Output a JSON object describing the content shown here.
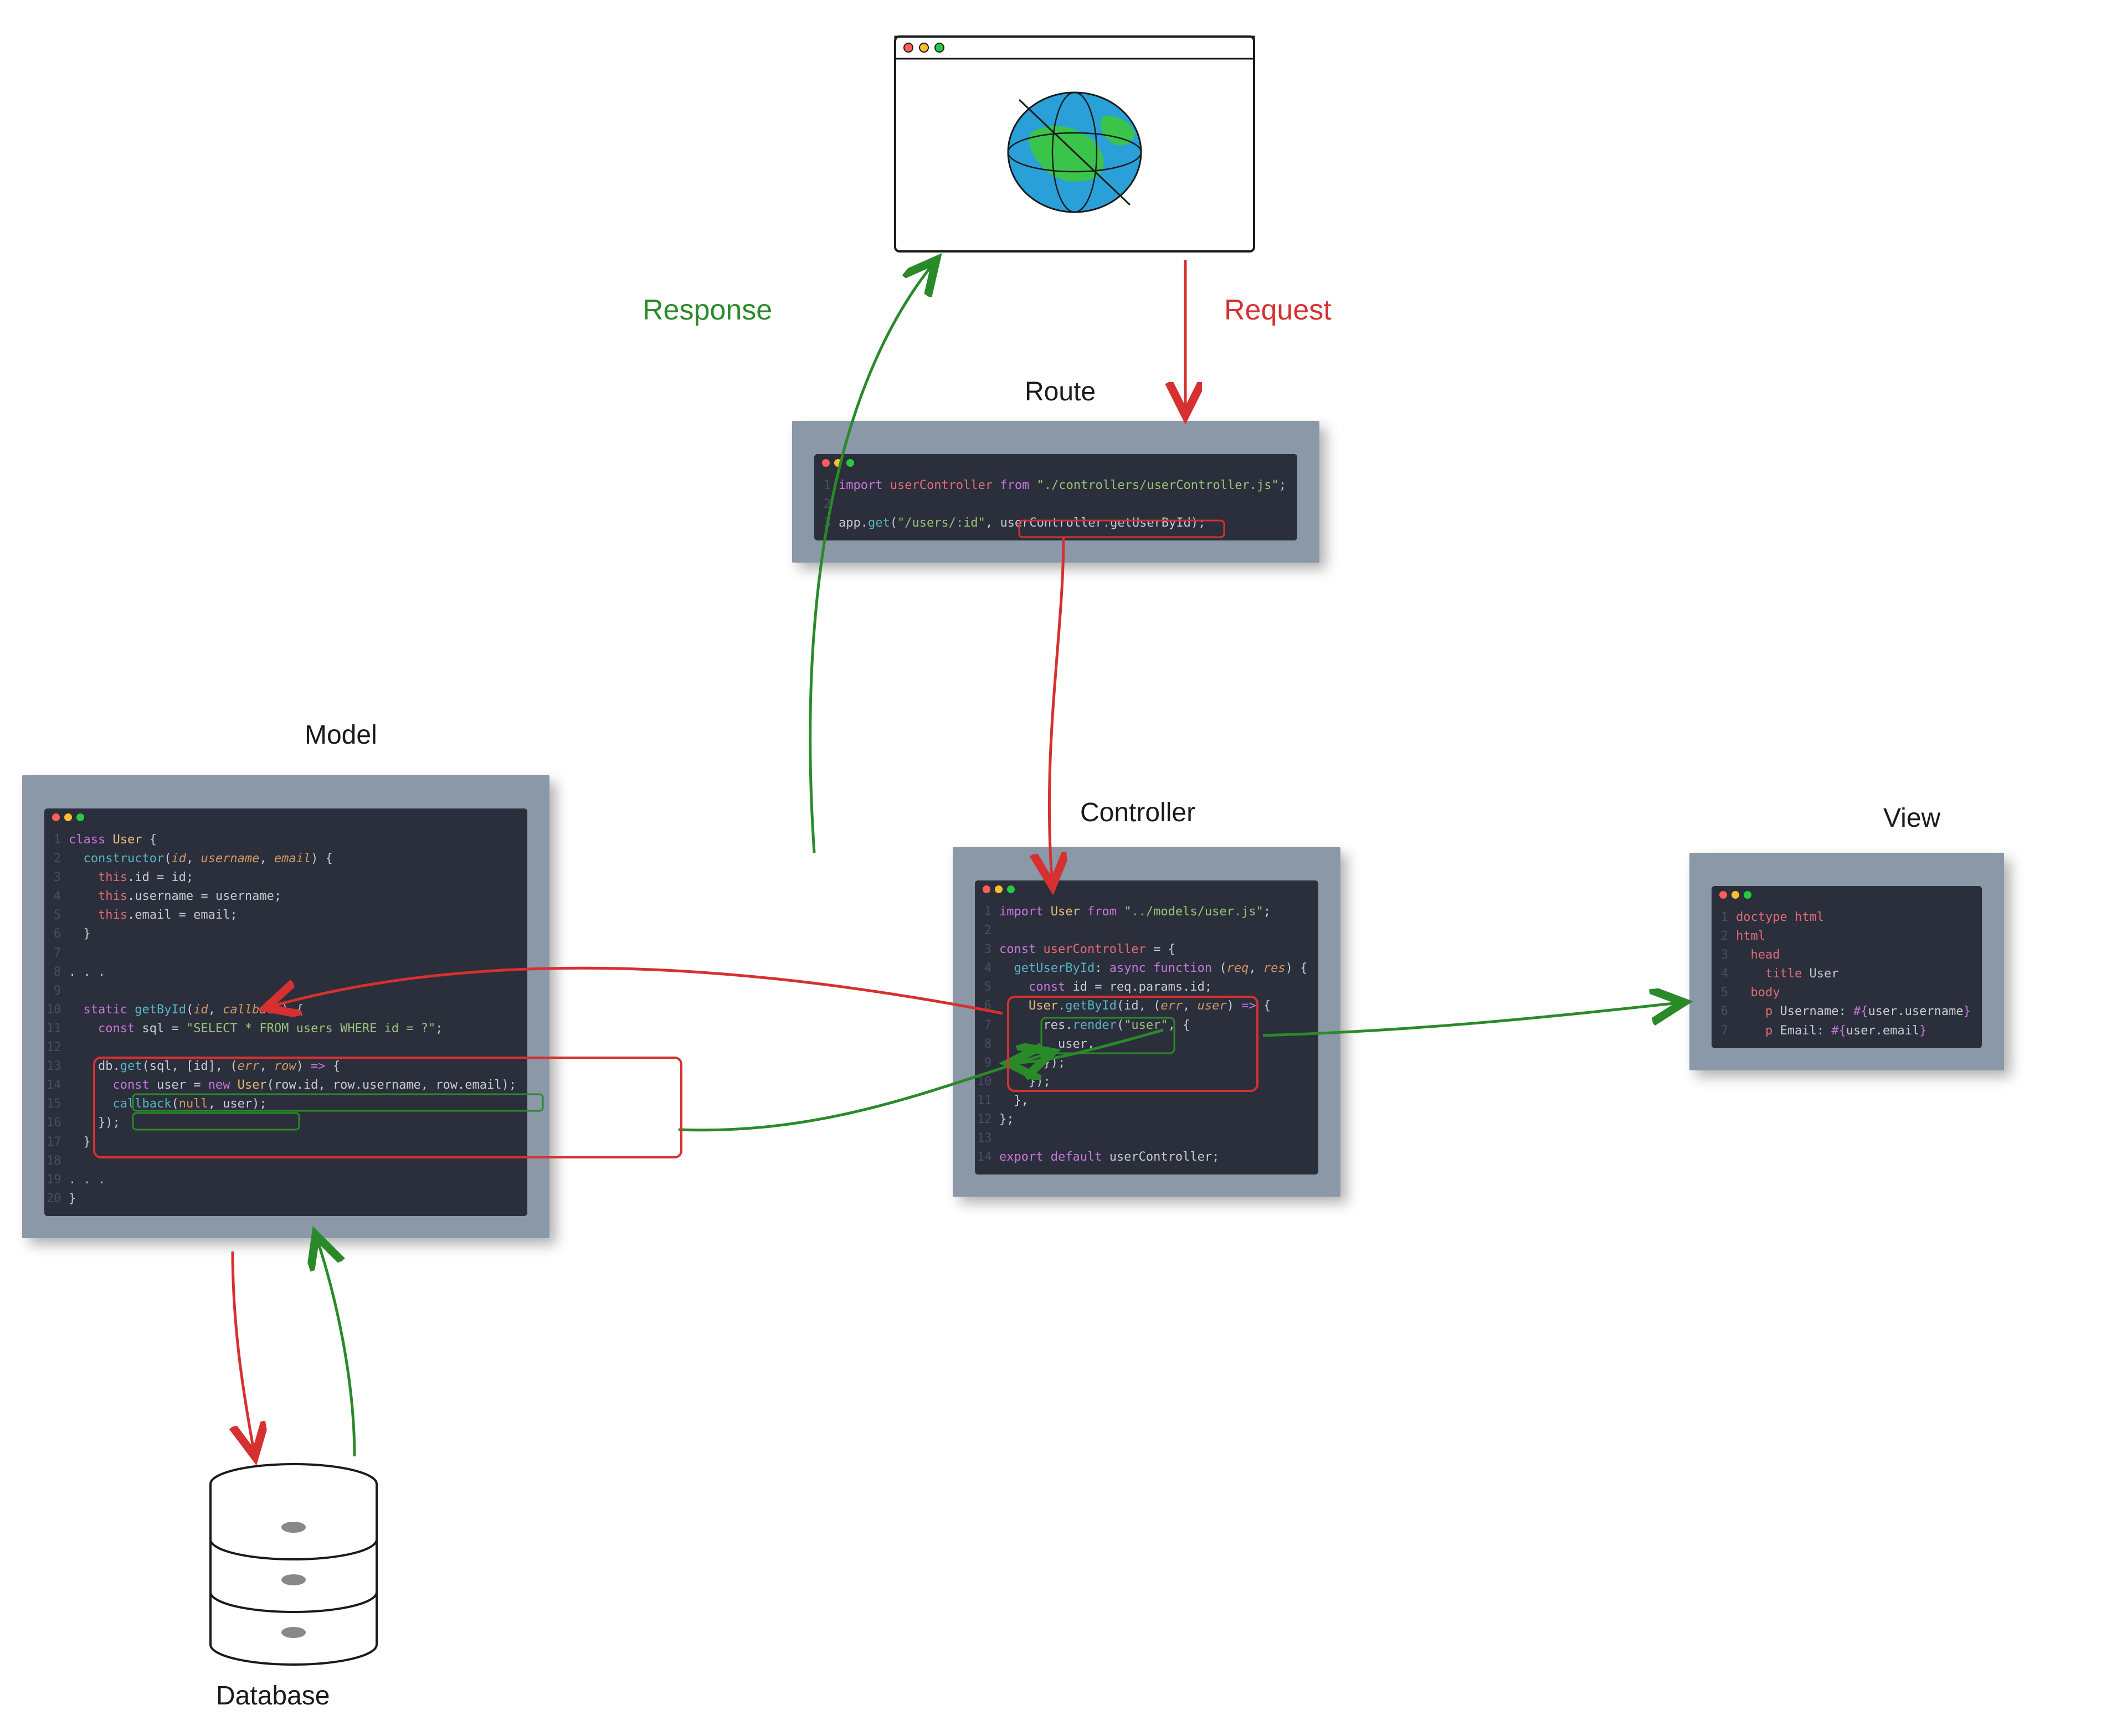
{
  "labels": {
    "response": "Response",
    "request": "Request",
    "route": "Route",
    "controller": "Controller",
    "model": "Model",
    "view": "View",
    "database": "Database"
  },
  "route": {
    "lines": [
      [
        {
          "t": "import ",
          "c": "kw"
        },
        {
          "t": "userController",
          "c": "prop"
        },
        {
          "t": " from ",
          "c": "kw"
        },
        {
          "t": "\"./controllers/userController.js\"",
          "c": "str"
        },
        {
          "t": ";"
        }
      ],
      [],
      [
        {
          "t": "app."
        },
        {
          "t": "get",
          "c": "fn"
        },
        {
          "t": "("
        },
        {
          "t": "\"/users/:id\"",
          "c": "str"
        },
        {
          "t": ", "
        },
        {
          "t": "userController.getUserById"
        },
        {
          "t": ");"
        }
      ]
    ]
  },
  "controller": {
    "lines": [
      [
        {
          "t": "import ",
          "c": "kw"
        },
        {
          "t": "User",
          "c": "ident"
        },
        {
          "t": " from ",
          "c": "kw"
        },
        {
          "t": "\"../models/user.js\"",
          "c": "str"
        },
        {
          "t": ";"
        }
      ],
      [],
      [
        {
          "t": "const ",
          "c": "kw"
        },
        {
          "t": "userController",
          "c": "prop"
        },
        {
          "t": " = {"
        }
      ],
      [
        {
          "t": "  "
        },
        {
          "t": "getUserById",
          "c": "fn"
        },
        {
          "t": ": "
        },
        {
          "t": "async function ",
          "c": "kw"
        },
        {
          "t": "("
        },
        {
          "t": "req",
          "c": "param"
        },
        {
          "t": ", "
        },
        {
          "t": "res",
          "c": "param"
        },
        {
          "t": ") {"
        }
      ],
      [
        {
          "t": "    "
        },
        {
          "t": "const ",
          "c": "kw"
        },
        {
          "t": "id = req.params.id;"
        }
      ],
      [
        {
          "t": "    "
        },
        {
          "t": "User",
          "c": "ident"
        },
        {
          "t": "."
        },
        {
          "t": "getById",
          "c": "fn"
        },
        {
          "t": "(id, ("
        },
        {
          "t": "err",
          "c": "param"
        },
        {
          "t": ", "
        },
        {
          "t": "user",
          "c": "param"
        },
        {
          "t": ") "
        },
        {
          "t": "=>",
          "c": "kw"
        },
        {
          "t": " {"
        }
      ],
      [
        {
          "t": "      res."
        },
        {
          "t": "render",
          "c": "fn"
        },
        {
          "t": "("
        },
        {
          "t": "\"user\"",
          "c": "str"
        },
        {
          "t": ", {"
        }
      ],
      [
        {
          "t": "        user,"
        }
      ],
      [
        {
          "t": "      });"
        }
      ],
      [
        {
          "t": "    });"
        }
      ],
      [
        {
          "t": "  },"
        }
      ],
      [
        {
          "t": "};"
        }
      ],
      [],
      [
        {
          "t": "export default ",
          "c": "kw"
        },
        {
          "t": "userController;"
        }
      ]
    ]
  },
  "model": {
    "lines": [
      [
        {
          "t": "class ",
          "c": "kw"
        },
        {
          "t": "User",
          "c": "ident"
        },
        {
          "t": " {"
        }
      ],
      [
        {
          "t": "  "
        },
        {
          "t": "constructor",
          "c": "fn"
        },
        {
          "t": "("
        },
        {
          "t": "id",
          "c": "param"
        },
        {
          "t": ", "
        },
        {
          "t": "username",
          "c": "param"
        },
        {
          "t": ", "
        },
        {
          "t": "email",
          "c": "param"
        },
        {
          "t": ") {"
        }
      ],
      [
        {
          "t": "    "
        },
        {
          "t": "this",
          "c": "this"
        },
        {
          "t": ".id = id;"
        }
      ],
      [
        {
          "t": "    "
        },
        {
          "t": "this",
          "c": "this"
        },
        {
          "t": ".username = username;"
        }
      ],
      [
        {
          "t": "    "
        },
        {
          "t": "this",
          "c": "this"
        },
        {
          "t": ".email = email;"
        }
      ],
      [
        {
          "t": "  }"
        }
      ],
      [],
      [
        {
          "t": ". . ."
        }
      ],
      [],
      [
        {
          "t": "  "
        },
        {
          "t": "static ",
          "c": "kw"
        },
        {
          "t": "getById",
          "c": "fn"
        },
        {
          "t": "("
        },
        {
          "t": "id",
          "c": "param"
        },
        {
          "t": ", "
        },
        {
          "t": "callback",
          "c": "param"
        },
        {
          "t": ") {"
        }
      ],
      [
        {
          "t": "    "
        },
        {
          "t": "const ",
          "c": "kw"
        },
        {
          "t": "sql = "
        },
        {
          "t": "\"SELECT * FROM users WHERE id = ?\"",
          "c": "str"
        },
        {
          "t": ";"
        }
      ],
      [],
      [
        {
          "t": "    db."
        },
        {
          "t": "get",
          "c": "fn"
        },
        {
          "t": "(sql, [id], ("
        },
        {
          "t": "err",
          "c": "param"
        },
        {
          "t": ", "
        },
        {
          "t": "row",
          "c": "param"
        },
        {
          "t": ") "
        },
        {
          "t": "=>",
          "c": "kw"
        },
        {
          "t": " {"
        }
      ],
      [
        {
          "t": "      "
        },
        {
          "t": "const ",
          "c": "kw"
        },
        {
          "t": "user = "
        },
        {
          "t": "new ",
          "c": "kw"
        },
        {
          "t": "User",
          "c": "ident"
        },
        {
          "t": "(row.id, row.username, row.email);"
        }
      ],
      [
        {
          "t": "      "
        },
        {
          "t": "callback",
          "c": "fn"
        },
        {
          "t": "("
        },
        {
          "t": "null",
          "c": "num"
        },
        {
          "t": ", user);"
        }
      ],
      [
        {
          "t": "    });"
        }
      ],
      [
        {
          "t": "  }"
        }
      ],
      [],
      [
        {
          "t": ". . ."
        }
      ],
      [
        {
          "t": "}"
        }
      ]
    ]
  },
  "view": {
    "lines": [
      [
        {
          "t": "doctype html",
          "c": "prop"
        }
      ],
      [
        {
          "t": "html",
          "c": "prop"
        }
      ],
      [
        {
          "t": "  "
        },
        {
          "t": "head",
          "c": "prop"
        }
      ],
      [
        {
          "t": "    "
        },
        {
          "t": "title",
          "c": "prop"
        },
        {
          "t": " User"
        }
      ],
      [
        {
          "t": "  "
        },
        {
          "t": "body",
          "c": "prop"
        }
      ],
      [
        {
          "t": "    "
        },
        {
          "t": "p",
          "c": "prop"
        },
        {
          "t": " Username: "
        },
        {
          "t": "#{",
          "c": "kw"
        },
        {
          "t": "user.username"
        },
        {
          "t": "}",
          "c": "kw"
        }
      ],
      [
        {
          "t": "    "
        },
        {
          "t": "p",
          "c": "prop"
        },
        {
          "t": " Email: "
        },
        {
          "t": "#{",
          "c": "kw"
        },
        {
          "t": "user.email"
        },
        {
          "t": "}",
          "c": "kw"
        }
      ]
    ]
  },
  "colors": {
    "request_arrow": "#d63030",
    "response_arrow": "#2a8a2a",
    "highlight_red": "#d63030",
    "highlight_green": "#2a8a2a"
  }
}
